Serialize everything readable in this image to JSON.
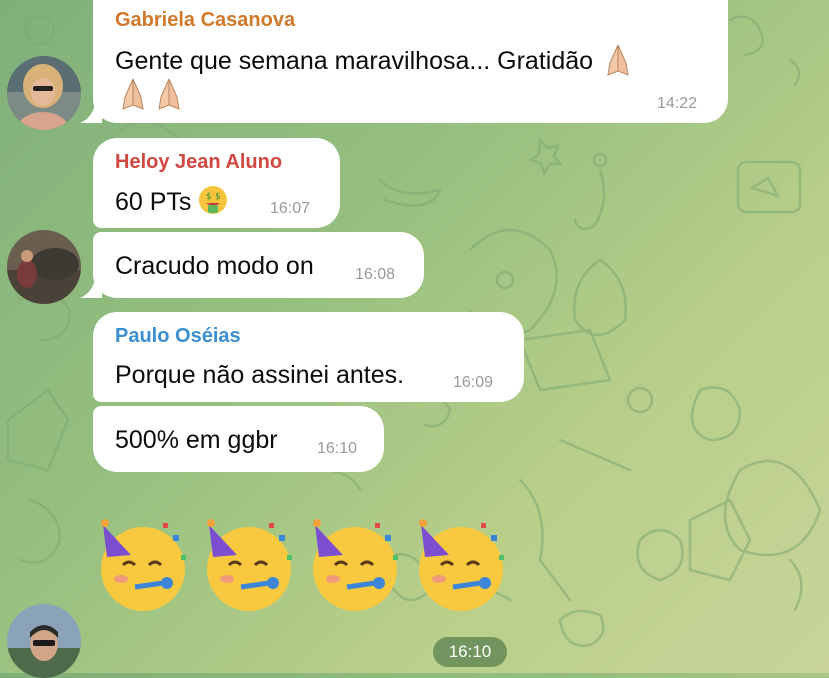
{
  "messages": [
    {
      "sender": "Gabriela Casanova",
      "sender_color": "#d0792c",
      "text_line1": "Gente que semana maravilhosa... Gratidão",
      "time": "14:22",
      "emoji_in_text": "folded-hands"
    },
    {
      "sender": "Heloy Jean Aluno",
      "sender_color": "#d0483f",
      "text": "60 PTs",
      "time": "16:07",
      "emoji_in_text": "money-mouth-face"
    },
    {
      "text": "Cracudo modo on",
      "time": "16:08"
    },
    {
      "sender": "Paulo Oséias",
      "sender_color": "#3a8fd0",
      "text": "Porque não assinei antes.",
      "time": "16:09"
    },
    {
      "text": "500% em ggbr",
      "time": "16:10"
    }
  ],
  "sticker_message": {
    "emoji": "partying-face",
    "count": 4,
    "time": "16:10"
  },
  "colors": {
    "bubble": "#ffffff",
    "timestamp": "#9a9a9a",
    "wallpaper": "#97c07f"
  }
}
